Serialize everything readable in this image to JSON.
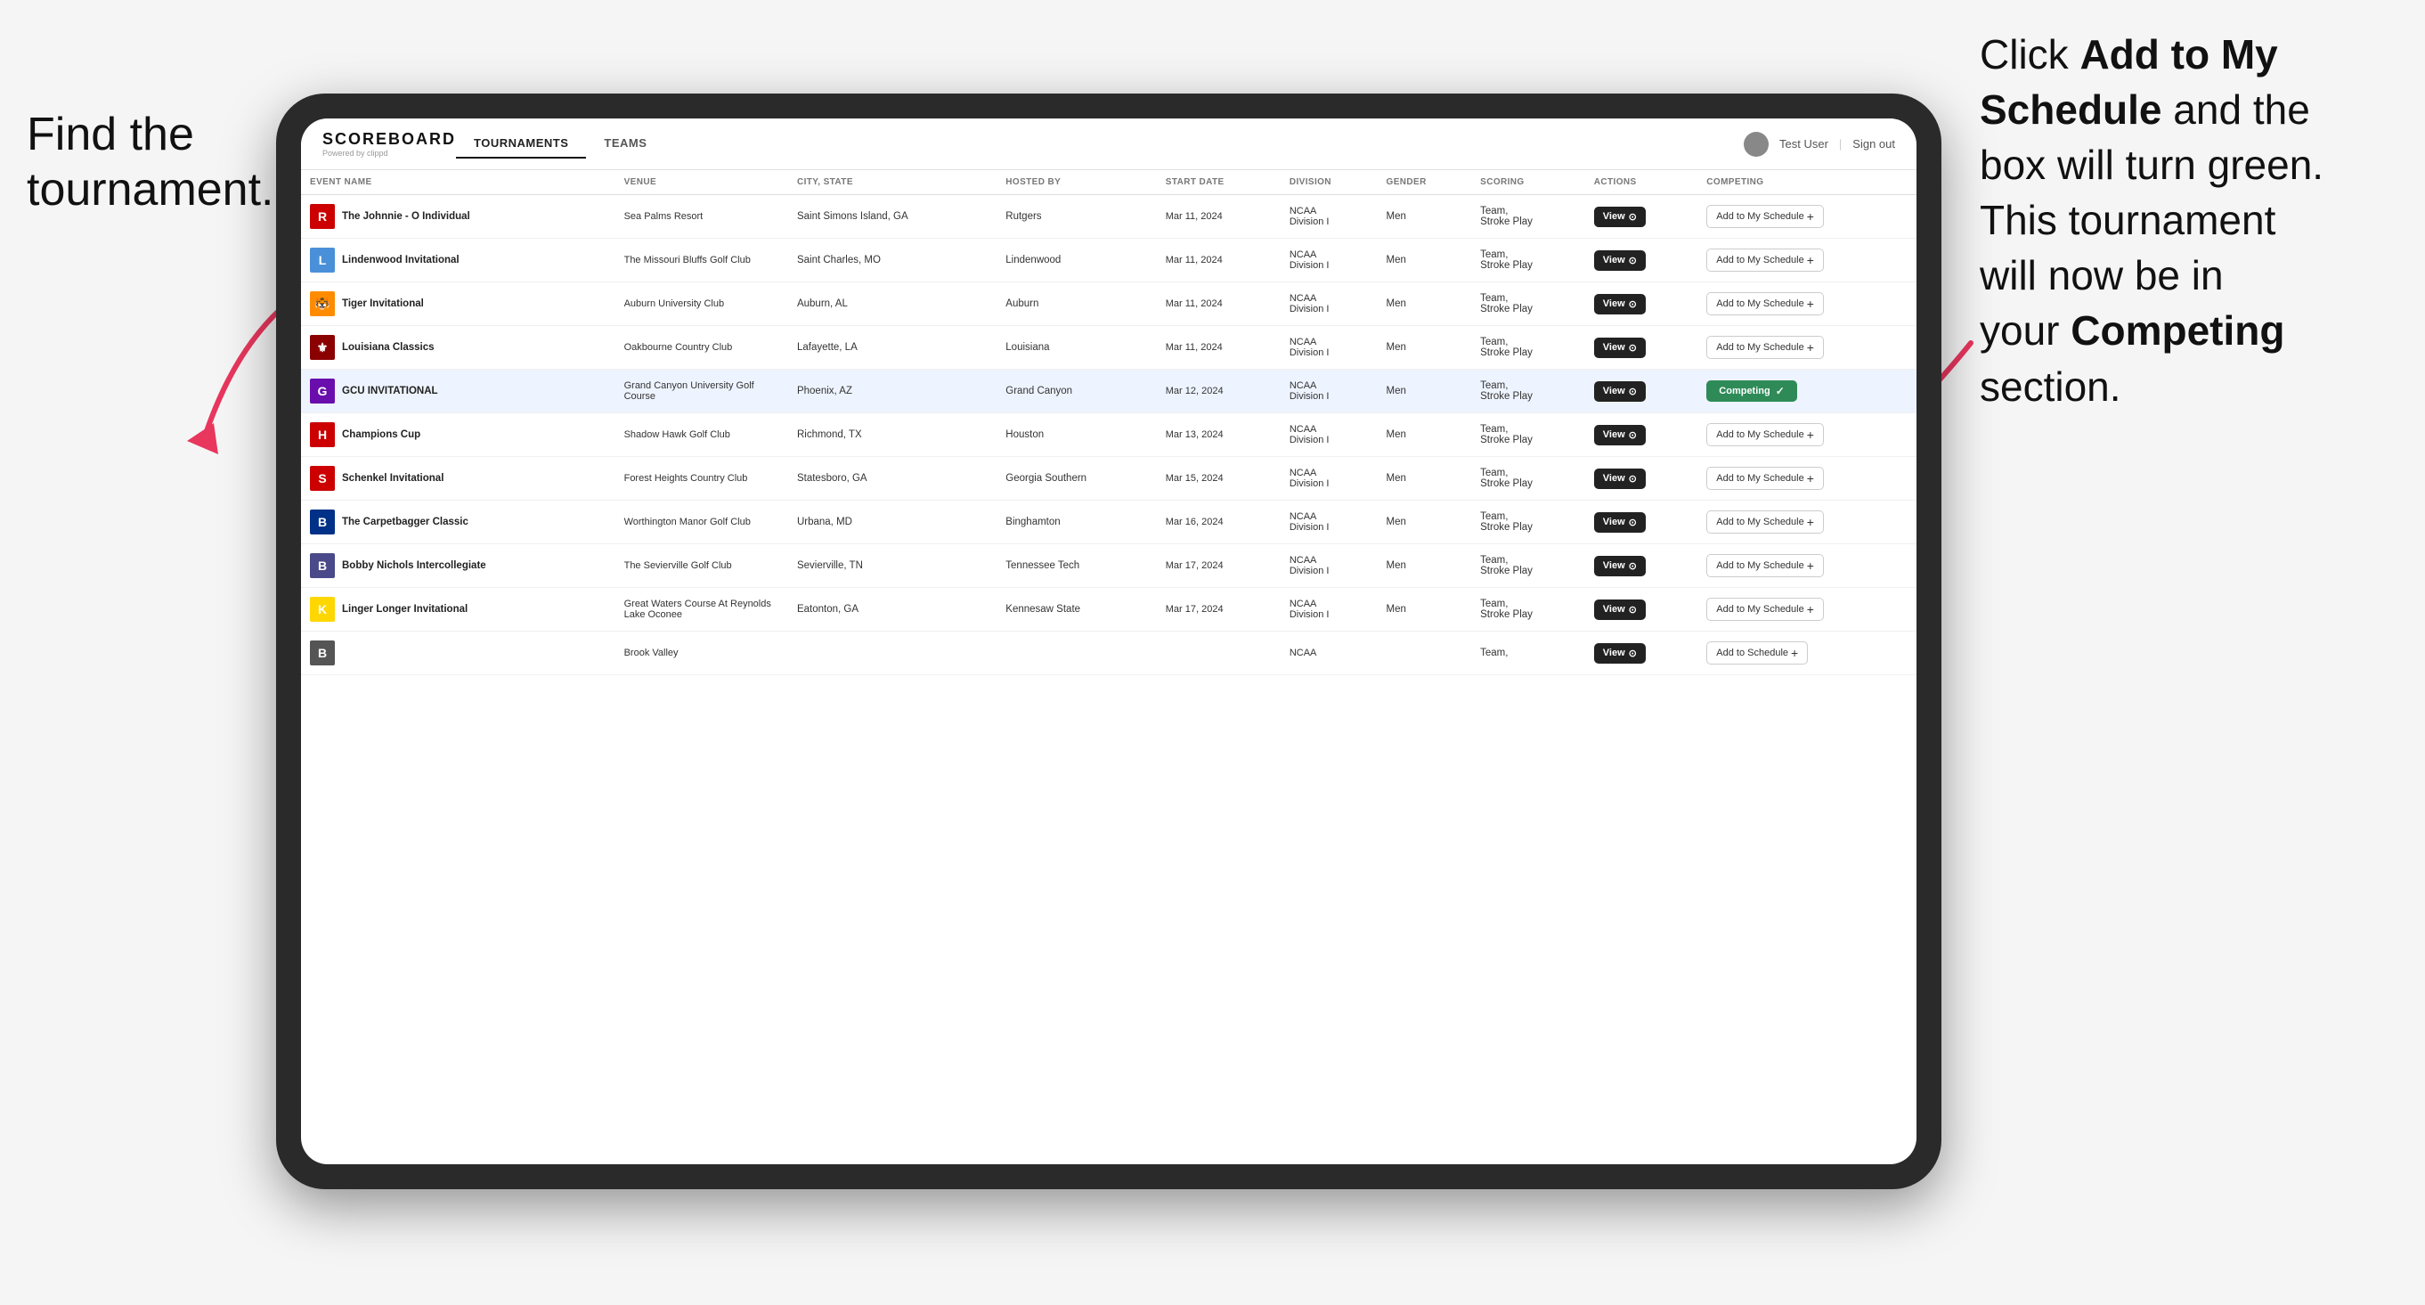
{
  "annotations": {
    "left": "Find the\ntournament.",
    "right_line1": "Click ",
    "right_bold1": "Add to My\nSchedule",
    "right_line2": " and the\nbox will turn green.\nThis tournament\nwill now be in\nyour ",
    "right_bold2": "Competing",
    "right_line3": "\nsection."
  },
  "header": {
    "logo": "SCOREBOARD",
    "logo_sub": "Powered by clippd",
    "nav_tabs": [
      "TOURNAMENTS",
      "TEAMS"
    ],
    "active_tab": "TOURNAMENTS",
    "user_text": "Test User",
    "signout_text": "Sign out"
  },
  "table": {
    "columns": [
      "EVENT NAME",
      "VENUE",
      "CITY, STATE",
      "HOSTED BY",
      "START DATE",
      "DIVISION",
      "GENDER",
      "SCORING",
      "ACTIONS",
      "COMPETING"
    ],
    "rows": [
      {
        "logo": "R",
        "logo_bg": "#cc0000",
        "event": "The Johnnie - O Individual",
        "venue": "Sea Palms Resort",
        "city": "Saint Simons Island, GA",
        "host": "Rutgers",
        "date": "Mar 11, 2024",
        "division": "NCAA Division I",
        "gender": "Men",
        "scoring": "Team, Stroke Play",
        "action": "View",
        "competing": "Add to My Schedule",
        "is_competing": false,
        "highlighted": false
      },
      {
        "logo": "L",
        "logo_bg": "#4a90d9",
        "event": "Lindenwood Invitational",
        "venue": "The Missouri Bluffs Golf Club",
        "city": "Saint Charles, MO",
        "host": "Lindenwood",
        "date": "Mar 11, 2024",
        "division": "NCAA Division I",
        "gender": "Men",
        "scoring": "Team, Stroke Play",
        "action": "View",
        "competing": "Add to My Schedule",
        "is_competing": false,
        "highlighted": false
      },
      {
        "logo": "🐯",
        "logo_bg": "#ff8c00",
        "event": "Tiger Invitational",
        "venue": "Auburn University Club",
        "city": "Auburn, AL",
        "host": "Auburn",
        "date": "Mar 11, 2024",
        "division": "NCAA Division I",
        "gender": "Men",
        "scoring": "Team, Stroke Play",
        "action": "View",
        "competing": "Add to My Schedule",
        "is_competing": false,
        "highlighted": false
      },
      {
        "logo": "⚜",
        "logo_bg": "#8b0000",
        "event": "Louisiana Classics",
        "venue": "Oakbourne Country Club",
        "city": "Lafayette, LA",
        "host": "Louisiana",
        "date": "Mar 11, 2024",
        "division": "NCAA Division I",
        "gender": "Men",
        "scoring": "Team, Stroke Play",
        "action": "View",
        "competing": "Add to My Schedule",
        "is_competing": false,
        "highlighted": false
      },
      {
        "logo": "G",
        "logo_bg": "#6a0dad",
        "event": "GCU INVITATIONAL",
        "venue": "Grand Canyon University Golf Course",
        "city": "Phoenix, AZ",
        "host": "Grand Canyon",
        "date": "Mar 12, 2024",
        "division": "NCAA Division I",
        "gender": "Men",
        "scoring": "Team, Stroke Play",
        "action": "View",
        "competing": "Competing",
        "is_competing": true,
        "highlighted": true
      },
      {
        "logo": "H",
        "logo_bg": "#cc0000",
        "event": "Champions Cup",
        "venue": "Shadow Hawk Golf Club",
        "city": "Richmond, TX",
        "host": "Houston",
        "date": "Mar 13, 2024",
        "division": "NCAA Division I",
        "gender": "Men",
        "scoring": "Team, Stroke Play",
        "action": "View",
        "competing": "Add to My Schedule",
        "is_competing": false,
        "highlighted": false
      },
      {
        "logo": "S",
        "logo_bg": "#cc0000",
        "event": "Schenkel Invitational",
        "venue": "Forest Heights Country Club",
        "city": "Statesboro, GA",
        "host": "Georgia Southern",
        "date": "Mar 15, 2024",
        "division": "NCAA Division I",
        "gender": "Men",
        "scoring": "Team, Stroke Play",
        "action": "View",
        "competing": "Add to My Schedule",
        "is_competing": false,
        "highlighted": false
      },
      {
        "logo": "B",
        "logo_bg": "#003087",
        "event": "The Carpetbagger Classic",
        "venue": "Worthington Manor Golf Club",
        "city": "Urbana, MD",
        "host": "Binghamton",
        "date": "Mar 16, 2024",
        "division": "NCAA Division I",
        "gender": "Men",
        "scoring": "Team, Stroke Play",
        "action": "View",
        "competing": "Add to My Schedule",
        "is_competing": false,
        "highlighted": false
      },
      {
        "logo": "B",
        "logo_bg": "#4a4a8a",
        "event": "Bobby Nichols Intercollegiate",
        "venue": "The Sevierville Golf Club",
        "city": "Sevierville, TN",
        "host": "Tennessee Tech",
        "date": "Mar 17, 2024",
        "division": "NCAA Division I",
        "gender": "Men",
        "scoring": "Team, Stroke Play",
        "action": "View",
        "competing": "Add to My Schedule",
        "is_competing": false,
        "highlighted": false
      },
      {
        "logo": "K",
        "logo_bg": "#ffd700",
        "event": "Linger Longer Invitational",
        "venue": "Great Waters Course At Reynolds Lake Oconee",
        "city": "Eatonton, GA",
        "host": "Kennesaw State",
        "date": "Mar 17, 2024",
        "division": "NCAA Division I",
        "gender": "Men",
        "scoring": "Team, Stroke Play",
        "action": "View",
        "competing": "Add to My Schedule",
        "is_competing": false,
        "highlighted": false
      },
      {
        "logo": "B",
        "logo_bg": "#555",
        "event": "",
        "venue": "Brook Valley",
        "city": "",
        "host": "",
        "date": "",
        "division": "NCAA",
        "gender": "",
        "scoring": "Team,",
        "action": "View",
        "competing": "Add to Schedule",
        "is_competing": false,
        "highlighted": false
      }
    ]
  }
}
